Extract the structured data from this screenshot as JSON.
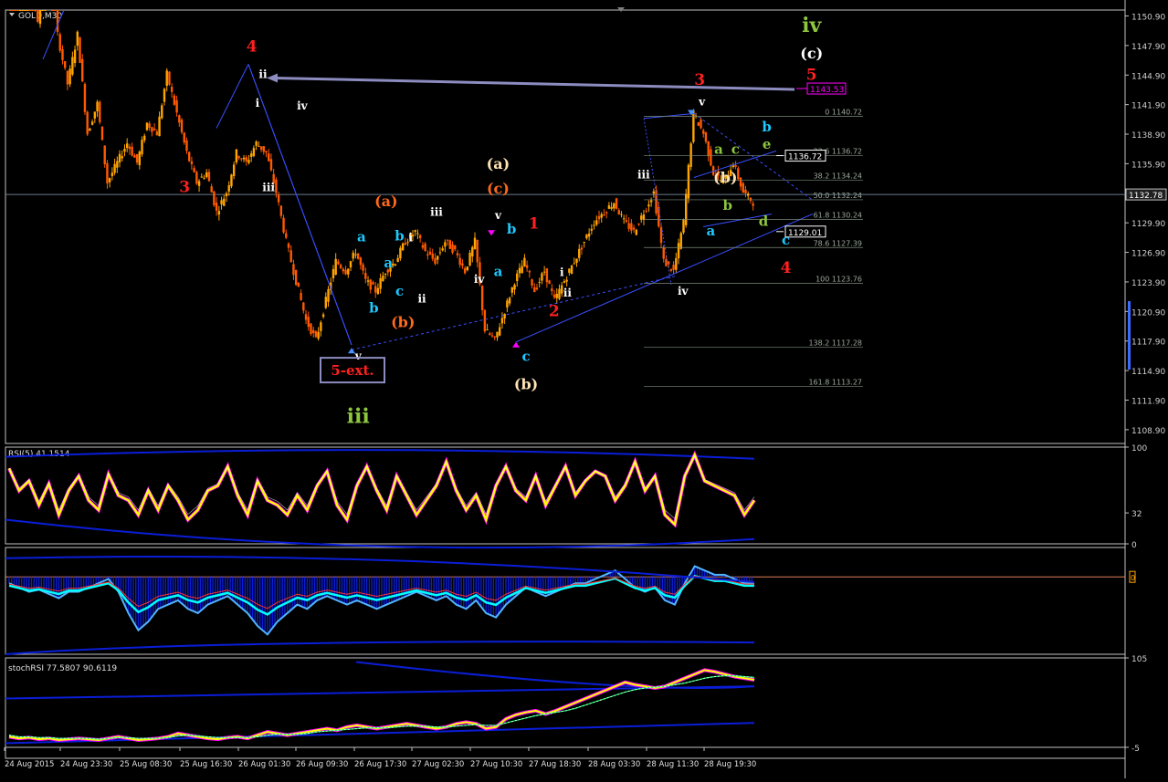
{
  "colors": {
    "background": "#000000",
    "frame": "#c0c0c0",
    "grid": "#2e3c4a",
    "bull_candle": "#ffa500",
    "bear_candle": "#ff5a00",
    "trendline": "#3a4fff",
    "rsi_main": "#ffff00",
    "rsi_shadow": "#ff00ff",
    "band": "#0a1ed8",
    "histogram": "#0a1ed8",
    "hist_light": "#50b4ff",
    "cyan_line": "#00ffff",
    "arrow": "#8c8cc0",
    "fib": "#7a8a7a",
    "zero_line": "#ff9060"
  },
  "chart_data": [
    {
      "type": "candlestick",
      "title": "GOLD,M30",
      "yticks": [
        "1150.90",
        "1147.90",
        "1144.90",
        "1141.90",
        "1138.90",
        "1135.90",
        "1132.90",
        "1129.90",
        "1126.90",
        "1123.90",
        "1120.90",
        "1117.90",
        "1114.90",
        "1111.90",
        "1108.90"
      ],
      "ylim": [
        1107.5,
        1151.5
      ],
      "current_price": "1132.78",
      "price_path": [
        1157,
        1152,
        1158,
        1150,
        1161,
        1149,
        1144,
        1149,
        1139,
        1142,
        1134,
        1136,
        1138,
        1136,
        1140,
        1139,
        1145,
        1141,
        1137,
        1134,
        1135,
        1131,
        1133,
        1137,
        1136,
        1138,
        1137,
        1133,
        1128,
        1124,
        1120,
        1118,
        1122,
        1126,
        1125,
        1127,
        1124,
        1123,
        1125,
        1126,
        1128,
        1129,
        1127,
        1126,
        1128,
        1127,
        1125,
        1128,
        1119,
        1118,
        1121,
        1124,
        1126,
        1123,
        1125,
        1122,
        1124,
        1126,
        1128,
        1130,
        1131,
        1132,
        1130,
        1129,
        1131,
        1133,
        1126,
        1125,
        1130,
        1141,
        1139,
        1135,
        1134,
        1136,
        1133,
        1132
      ],
      "hline_price_label": "1143.53",
      "box_labels": [
        {
          "text": "1136.72",
          "price": 1136.72
        },
        {
          "text": "1129.01",
          "price": 1129.01
        }
      ],
      "fib_levels": [
        {
          "label": "0 1140.72",
          "price": 1140.72
        },
        {
          "label": "23.6 1136.72",
          "price": 1136.72
        },
        {
          "label": "38.2 1134.24",
          "price": 1134.24
        },
        {
          "label": "50.0 1132.24",
          "price": 1132.24
        },
        {
          "label": "61.8 1130.24",
          "price": 1130.24
        },
        {
          "label": "78.6 1127.39",
          "price": 1127.39
        },
        {
          "label": "100 1123.76",
          "price": 1123.76
        },
        {
          "label": "138.2 1117.28",
          "price": 1117.28
        },
        {
          "label": "161.8 1113.27",
          "price": 1113.27
        }
      ],
      "wave_labels": [
        {
          "t": "iv",
          "price": 1149.3,
          "x": 0.72,
          "c": "#8dc63f",
          "s": 22
        },
        {
          "t": "(c)",
          "price": 1146.6,
          "x": 0.72,
          "c": "#ffffff",
          "s": 16
        },
        {
          "t": "5",
          "price": 1144.4,
          "x": 0.72,
          "c": "#ff2020",
          "s": 17
        },
        {
          "t": "3",
          "price": 1143.9,
          "x": 0.62,
          "c": "#ff2020",
          "s": 17
        },
        {
          "t": "4",
          "price": 1147.3,
          "x": 0.22,
          "c": "#ff2020",
          "s": 17
        },
        {
          "t": "ii",
          "price": 1144.6,
          "x": 0.23,
          "c": "#ffffff",
          "s": 12
        },
        {
          "t": "i",
          "price": 1141.7,
          "x": 0.225,
          "c": "#ffffff",
          "s": 12
        },
        {
          "t": "iv",
          "price": 1141.4,
          "x": 0.265,
          "c": "#ffffff",
          "s": 12
        },
        {
          "t": "3",
          "price": 1133.0,
          "x": 0.16,
          "c": "#ff2020",
          "s": 17
        },
        {
          "t": "iii",
          "price": 1133.1,
          "x": 0.235,
          "c": "#ffffff",
          "s": 12
        },
        {
          "t": "(a)",
          "price": 1131.6,
          "x": 0.34,
          "c": "#ff6a1a",
          "s": 16
        },
        {
          "t": "(a)",
          "price": 1135.4,
          "x": 0.44,
          "c": "#ffe4b5",
          "s": 16
        },
        {
          "t": "(c)",
          "price": 1132.9,
          "x": 0.44,
          "c": "#ff6a1a",
          "s": 16
        },
        {
          "t": "iii",
          "price": 1130.6,
          "x": 0.385,
          "c": "#ffffff",
          "s": 12
        },
        {
          "t": "v",
          "price": 1130.3,
          "x": 0.44,
          "c": "#ffffff",
          "s": 12
        },
        {
          "t": "1",
          "price": 1129.3,
          "x": 0.472,
          "c": "#ff2020",
          "s": 17
        },
        {
          "t": "a",
          "price": 1128.0,
          "x": 0.318,
          "c": "#1ec8ff",
          "s": 15
        },
        {
          "t": "b",
          "price": 1128.1,
          "x": 0.352,
          "c": "#1ec8ff",
          "s": 15
        },
        {
          "t": "i",
          "price": 1128.0,
          "x": 0.362,
          "c": "#ffffff",
          "s": 12
        },
        {
          "t": "b",
          "price": 1128.8,
          "x": 0.452,
          "c": "#1ec8ff",
          "s": 15
        },
        {
          "t": "a",
          "price": 1125.4,
          "x": 0.342,
          "c": "#1ec8ff",
          "s": 15
        },
        {
          "t": "a",
          "price": 1124.5,
          "x": 0.44,
          "c": "#1ec8ff",
          "s": 15
        },
        {
          "t": "iv",
          "price": 1123.8,
          "x": 0.423,
          "c": "#ffffff",
          "s": 12
        },
        {
          "t": "i",
          "price": 1124.5,
          "x": 0.497,
          "c": "#ffffff",
          "s": 12
        },
        {
          "t": "ii",
          "price": 1122.4,
          "x": 0.502,
          "c": "#ffffff",
          "s": 12
        },
        {
          "t": "c",
          "price": 1122.5,
          "x": 0.352,
          "c": "#1ec8ff",
          "s": 15
        },
        {
          "t": "ii",
          "price": 1121.8,
          "x": 0.372,
          "c": "#ffffff",
          "s": 12
        },
        {
          "t": "b",
          "price": 1120.8,
          "x": 0.329,
          "c": "#1ec8ff",
          "s": 15
        },
        {
          "t": "2",
          "price": 1120.4,
          "x": 0.49,
          "c": "#ff2020",
          "s": 17
        },
        {
          "t": "(b)",
          "price": 1119.3,
          "x": 0.355,
          "c": "#ff6a1a",
          "s": 16
        },
        {
          "t": "v",
          "price": 1116.0,
          "x": 0.315,
          "c": "#ffffff",
          "s": 12
        },
        {
          "t": "c",
          "price": 1115.9,
          "x": 0.465,
          "c": "#1ec8ff",
          "s": 15
        },
        {
          "t": "(b)",
          "price": 1113.0,
          "x": 0.465,
          "c": "#ffe4b5",
          "s": 16
        },
        {
          "t": "iii",
          "price": 1109.6,
          "x": 0.315,
          "c": "#8dc63f",
          "s": 22
        },
        {
          "t": "iii",
          "price": 1134.4,
          "x": 0.57,
          "c": "#ffffff",
          "s": 12
        },
        {
          "t": "v",
          "price": 1141.8,
          "x": 0.622,
          "c": "#ffffff",
          "s": 12
        },
        {
          "t": "b",
          "price": 1139.2,
          "x": 0.68,
          "c": "#1ec8ff",
          "s": 15
        },
        {
          "t": "a",
          "price": 1136.9,
          "x": 0.637,
          "c": "#8dc63f",
          "s": 15
        },
        {
          "t": "c",
          "price": 1136.9,
          "x": 0.652,
          "c": "#8dc63f",
          "s": 15
        },
        {
          "t": "e",
          "price": 1137.4,
          "x": 0.68,
          "c": "#8dc63f",
          "s": 15
        },
        {
          "t": "(b)",
          "price": 1134.0,
          "x": 0.643,
          "c": "#ffe4b5",
          "s": 16
        },
        {
          "t": "b",
          "price": 1131.2,
          "x": 0.645,
          "c": "#8dc63f",
          "s": 15
        },
        {
          "t": "d",
          "price": 1129.6,
          "x": 0.677,
          "c": "#8dc63f",
          "s": 15
        },
        {
          "t": "a",
          "price": 1128.6,
          "x": 0.63,
          "c": "#1ec8ff",
          "s": 15
        },
        {
          "t": "c",
          "price": 1127.7,
          "x": 0.697,
          "c": "#1ec8ff",
          "s": 15
        },
        {
          "t": "4",
          "price": 1124.8,
          "x": 0.697,
          "c": "#ff2020",
          "s": 17
        },
        {
          "t": "iv",
          "price": 1122.6,
          "x": 0.605,
          "c": "#ffffff",
          "s": 12
        }
      ],
      "boxed_label": {
        "text": "5-ext.",
        "color": "#ff2020",
        "border": "#8c8cc0"
      }
    },
    {
      "type": "line",
      "title": "RSI(5) 41.1514",
      "yticks": [
        "100",
        "32",
        "0"
      ],
      "ylim": [
        0,
        100
      ],
      "series": [
        {
          "values": [
            78,
            55,
            65,
            40,
            62,
            30,
            55,
            70,
            45,
            35,
            72,
            50,
            45,
            30,
            55,
            35,
            60,
            45,
            25,
            35,
            55,
            60,
            80,
            50,
            30,
            65,
            45,
            40,
            30,
            50,
            35,
            60,
            75,
            40,
            25,
            60,
            80,
            55,
            35,
            70,
            50,
            30,
            45,
            60,
            85,
            55,
            35,
            50,
            25,
            60,
            80,
            55,
            45,
            70,
            40,
            60,
            80,
            50,
            65,
            75,
            70,
            45,
            60,
            85,
            55,
            70,
            30,
            20,
            70,
            92,
            65,
            60,
            55,
            50,
            30,
            45
          ]
        }
      ]
    },
    {
      "type": "area",
      "title": "",
      "ylim": [
        -1,
        1
      ],
      "series": [
        {
          "values": [
            0.3,
            0.2,
            0.1,
            0.15,
            0.05,
            -0.05,
            0.1,
            0.1,
            0.2,
            0.3,
            0.4,
            0.1,
            -0.4,
            -0.8,
            -0.6,
            -0.3,
            -0.2,
            -0.1,
            -0.3,
            -0.4,
            -0.2,
            -0.1,
            0.0,
            -0.2,
            -0.4,
            -0.7,
            -0.9,
            -0.6,
            -0.4,
            -0.2,
            -0.3,
            -0.1,
            0.0,
            -0.1,
            -0.2,
            -0.1,
            -0.2,
            -0.3,
            -0.2,
            -0.1,
            0.0,
            0.1,
            0.0,
            -0.1,
            0.0,
            -0.2,
            -0.3,
            -0.1,
            -0.4,
            -0.5,
            -0.2,
            0.0,
            0.2,
            0.1,
            0.0,
            0.1,
            0.2,
            0.3,
            0.3,
            0.4,
            0.5,
            0.6,
            0.4,
            0.2,
            0.1,
            0.2,
            -0.1,
            -0.2,
            0.3,
            0.7,
            0.6,
            0.5,
            0.5,
            0.4,
            0.3,
            0.3
          ]
        }
      ]
    },
    {
      "type": "line",
      "title": "stochRSI 77.5807 90.6119",
      "yticks": [
        "105",
        "-5"
      ],
      "ylim": [
        -5,
        105
      ],
      "series": [
        {
          "values": [
            8,
            6,
            7,
            5,
            6,
            4,
            5,
            6,
            5,
            4,
            6,
            8,
            6,
            4,
            5,
            6,
            8,
            12,
            10,
            8,
            6,
            5,
            7,
            8,
            6,
            10,
            14,
            12,
            10,
            12,
            14,
            16,
            18,
            16,
            20,
            22,
            20,
            18,
            20,
            22,
            24,
            22,
            20,
            18,
            20,
            24,
            26,
            24,
            18,
            20,
            30,
            35,
            38,
            40,
            36,
            40,
            45,
            50,
            55,
            60,
            65,
            70,
            75,
            72,
            70,
            68,
            70,
            75,
            80,
            85,
            90,
            88,
            85,
            82,
            80,
            78
          ]
        },
        {
          "values": [
            10,
            8,
            8,
            7,
            7,
            6,
            6,
            6,
            6,
            5,
            6,
            7,
            7,
            6,
            6,
            6,
            7,
            9,
            10,
            9,
            8,
            7,
            7,
            7,
            7,
            8,
            10,
            11,
            11,
            11,
            12,
            14,
            15,
            16,
            17,
            18,
            19,
            19,
            19,
            20,
            21,
            21,
            21,
            20,
            20,
            21,
            22,
            23,
            22,
            22,
            25,
            28,
            31,
            34,
            36,
            38,
            40,
            43,
            47,
            51,
            55,
            59,
            63,
            66,
            68,
            69,
            70,
            72,
            74,
            77,
            80,
            82,
            83,
            83,
            82,
            81
          ]
        }
      ]
    }
  ],
  "x_axis_labels": [
    "24 Aug 2015",
    "24 Aug 23:30",
    "25 Aug 08:30",
    "25 Aug 16:30",
    "26 Aug 01:30",
    "26 Aug 09:30",
    "26 Aug 17:30",
    "27 Aug 02:30",
    "27 Aug 10:30",
    "27 Aug 18:30",
    "28 Aug 03:30",
    "28 Aug 11:30",
    "28 Aug 19:30"
  ],
  "macd_zero_marker": "0"
}
